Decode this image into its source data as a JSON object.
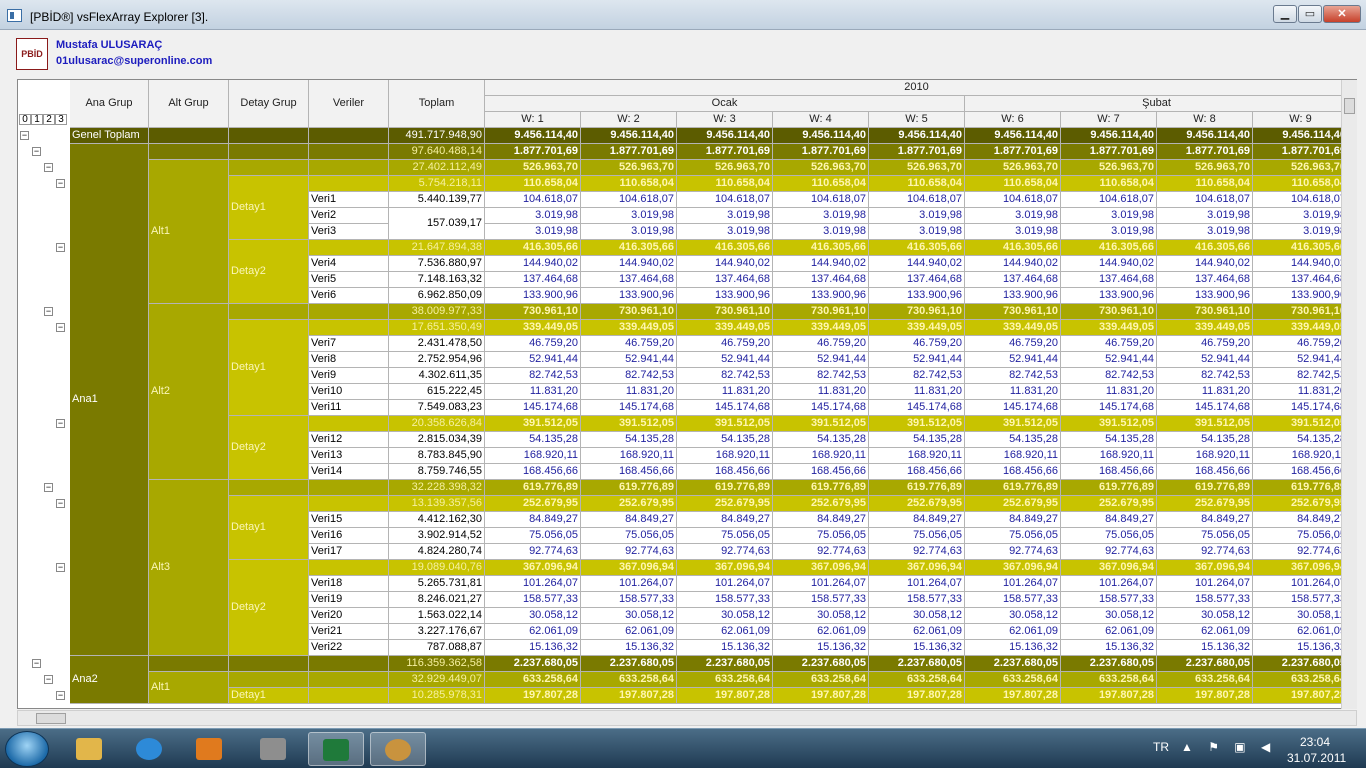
{
  "window": {
    "title": "[PBİD®] vsFlexArray Explorer [3].",
    "min": "▁",
    "max": "▭",
    "close": "✕"
  },
  "user": {
    "logo_text": "PBİD",
    "name": "Mustafa ULUSARAÇ",
    "email": "01ulusarac@superonline.com"
  },
  "grid": {
    "levels": [
      "0",
      "1",
      "2",
      "3"
    ],
    "headers": {
      "ana_grup": "Ana Grup",
      "alt_grup": "Alt Grup",
      "detay_grup": "Detay Grup",
      "veriler": "Veriler",
      "toplam": "Toplam"
    },
    "year": "2010",
    "months": [
      "Ocak",
      "Şubat"
    ],
    "weeks": [
      "W: 1",
      "W: 2",
      "W: 3",
      "W: 4",
      "W: 5",
      "W: 6",
      "W: 7",
      "W: 8",
      "W: 9"
    ],
    "groups": {
      "ana1": "Ana1",
      "ana2": "Ana2",
      "alt1": "Alt1",
      "alt2": "Alt2",
      "alt3": "Alt3",
      "detay1": "Detay1",
      "detay2": "Detay2"
    },
    "rows": [
      {
        "type": "genel",
        "label": "Genel Toplam",
        "total": "491.717.948,90",
        "week": "9.456.114,40"
      },
      {
        "type": "ana",
        "total": "97.640.488,14",
        "week": "1.877.701,69"
      },
      {
        "type": "alt",
        "total": "27.402.112,49",
        "week": "526.963,70"
      },
      {
        "type": "detay",
        "total": "5.754.218,11",
        "week": "110.658,04"
      },
      {
        "type": "veri",
        "label": "Veri1",
        "total": "5.440.139,77",
        "week": "104.618,07"
      },
      {
        "type": "veri",
        "label": "Veri2",
        "total": "",
        "week": "3.019,98"
      },
      {
        "type": "veri",
        "label": "Veri3",
        "total": "",
        "week": "3.019,98"
      },
      {
        "type": "detay",
        "total": "21.647.894,38",
        "week": "416.305,66"
      },
      {
        "type": "veri",
        "label": "Veri4",
        "total": "7.536.880,97",
        "week": "144.940,02"
      },
      {
        "type": "veri",
        "label": "Veri5",
        "total": "7.148.163,32",
        "week": "137.464,68"
      },
      {
        "type": "veri",
        "label": "Veri6",
        "total": "6.962.850,09",
        "week": "133.900,96"
      },
      {
        "type": "alt",
        "total": "38.009.977,33",
        "week": "730.961,10"
      },
      {
        "type": "detay",
        "total": "17.651.350,49",
        "week": "339.449,05"
      },
      {
        "type": "veri",
        "label": "Veri7",
        "total": "2.431.478,50",
        "week": "46.759,20"
      },
      {
        "type": "veri",
        "label": "Veri8",
        "total": "2.752.954,96",
        "week": "52.941,44"
      },
      {
        "type": "veri",
        "label": "Veri9",
        "total": "4.302.611,35",
        "week": "82.742,53"
      },
      {
        "type": "veri",
        "label": "Veri10",
        "total": "615.222,45",
        "week": "11.831,20"
      },
      {
        "type": "veri",
        "label": "Veri11",
        "total": "7.549.083,23",
        "week": "145.174,68"
      },
      {
        "type": "detay",
        "total": "20.358.626,84",
        "week": "391.512,05"
      },
      {
        "type": "veri",
        "label": "Veri12",
        "total": "2.815.034,39",
        "week": "54.135,28"
      },
      {
        "type": "veri",
        "label": "Veri13",
        "total": "8.783.845,90",
        "week": "168.920,11"
      },
      {
        "type": "veri",
        "label": "Veri14",
        "total": "8.759.746,55",
        "week": "168.456,66"
      },
      {
        "type": "alt",
        "total": "32.228.398,32",
        "week": "619.776,89"
      },
      {
        "type": "detay",
        "total": "13.139.357,56",
        "week": "252.679,95"
      },
      {
        "type": "veri",
        "label": "Veri15",
        "total": "4.412.162,30",
        "week": "84.849,27"
      },
      {
        "type": "veri",
        "label": "Veri16",
        "total": "3.902.914,52",
        "week": "75.056,05"
      },
      {
        "type": "veri",
        "label": "Veri17",
        "total": "4.824.280,74",
        "week": "92.774,63"
      },
      {
        "type": "detay",
        "total": "19.089.040,76",
        "week": "367.096,94"
      },
      {
        "type": "veri",
        "label": "Veri18",
        "total": "5.265.731,81",
        "week": "101.264,07"
      },
      {
        "type": "veri",
        "label": "Veri19",
        "total": "8.246.021,27",
        "week": "158.577,33"
      },
      {
        "type": "veri",
        "label": "Veri20",
        "total": "1.563.022,14",
        "week": "30.058,12"
      },
      {
        "type": "veri",
        "label": "Veri21",
        "total": "3.227.176,67",
        "week": "62.061,09"
      },
      {
        "type": "veri",
        "label": "Veri22",
        "total": "787.088,87",
        "week": "15.136,32"
      },
      {
        "type": "ana",
        "total": "116.359.362,58",
        "week": "2.237.680,05"
      },
      {
        "type": "alt",
        "total": "32.929.449,07",
        "week": "633.258,64"
      },
      {
        "type": "detay",
        "total": "10.285.978,31",
        "week": "197.807,28"
      }
    ],
    "merged_total_veri2_3": "157.039,17"
  },
  "colors": {
    "genel": "#5c5c00",
    "ana": "#7a7a00",
    "alt": "#a8a800",
    "detay": "#c8c300",
    "data_text": "#2222a0"
  },
  "taskbar": {
    "lang": "TR",
    "time": "23:04",
    "date": "31.07.2011",
    "tray_icons": "▲ ⚑ ▣ ◀"
  }
}
